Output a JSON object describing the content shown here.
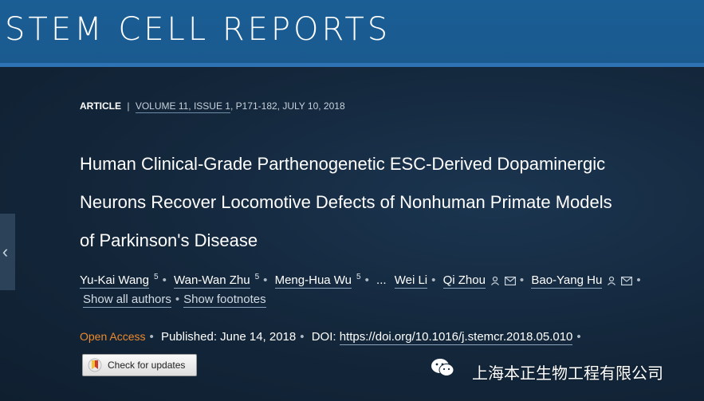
{
  "journal": {
    "name": "STEM CELL REPORTS"
  },
  "meta": {
    "article_type": "ARTICLE",
    "separator": "|",
    "volume_issue": "VOLUME 11, ISSUE 1",
    "pages_date": ", P171-182, JULY 10, 2018"
  },
  "article": {
    "title_line1": "Human Clinical-Grade Parthenogenetic ESC-Derived Dopaminergic",
    "title_line2": "Neurons Recover Locomotive Defects of Nonhuman Primate Models",
    "title_line3": "of Parkinson's Disease"
  },
  "authors": [
    {
      "name": "Yu-Kai Wang",
      "sup": "5"
    },
    {
      "name": "Wan-Wan Zhu",
      "sup": "5"
    },
    {
      "name": "Meng-Hua Wu",
      "sup": "5"
    },
    {
      "name": "Wei Li"
    },
    {
      "name": "Qi Zhou"
    },
    {
      "name": "Bao-Yang Hu"
    }
  ],
  "authors_ellipsis": "...",
  "author_actions": {
    "show_all": "Show all authors",
    "show_footnotes": "Show footnotes"
  },
  "publication": {
    "access": "Open Access",
    "published": "Published: June 14, 2018",
    "doi_label": "DOI:",
    "doi": "https://doi.org/10.1016/j.stemcr.2018.05.010"
  },
  "check_updates": {
    "label": "Check for updates"
  },
  "watermark": {
    "text": "上海本正生物工程有限公司"
  },
  "colors": {
    "header": "#1a5e95",
    "background": "#14273a",
    "open_access": "#ec8a2e"
  }
}
